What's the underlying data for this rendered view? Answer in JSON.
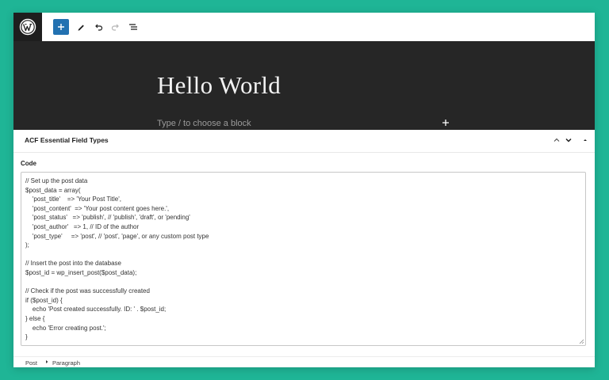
{
  "editor": {
    "post_title": "Hello World",
    "block_placeholder": "Type / to choose a block"
  },
  "toolbar": {
    "icons": [
      "wordpress-logo-icon",
      "plus-icon",
      "pencil-icon",
      "undo-icon",
      "redo-icon",
      "list-view-icon"
    ]
  },
  "meta_box": {
    "title": "ACF Essential Field Types",
    "field_label": "Code",
    "code": "// Set up the post data\n$post_data = array(\n    'post_title'    => 'Your Post Title',\n    'post_content'  => 'Your post content goes here.',\n    'post_status'   => 'publish', // 'publish', 'draft', or 'pending'\n    'post_author'   => 1, // ID of the author\n    'post_type'     => 'post', // 'post', 'page', or any custom post type\n);\n\n// Insert the post into the database\n$post_id = wp_insert_post($post_data);\n\n// Check if the post was successfully created\nif ($post_id) {\n    echo 'Post created successfully. ID: ' . $post_id;\n} else {\n    echo 'Error creating post.';\n}"
  },
  "breadcrumb": {
    "items": [
      "Post",
      "Paragraph"
    ]
  },
  "colors": {
    "background": "#1fb596",
    "accent": "#2271b1",
    "canvas": "#262626"
  }
}
